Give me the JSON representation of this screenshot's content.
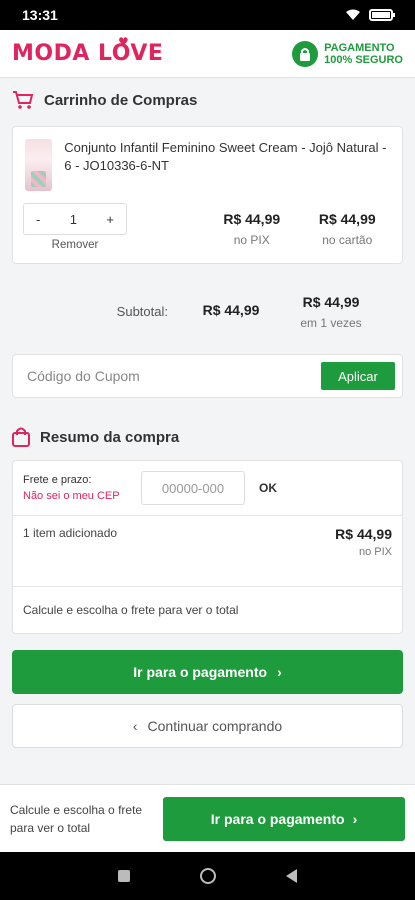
{
  "status_bar": {
    "time": "13:31"
  },
  "header": {
    "logo_text": "MODA LOVE",
    "secure_line1": "PAGAMENTO",
    "secure_line2": "100% SEGURO"
  },
  "cart": {
    "title": "Carrinho de Compras",
    "product_name": "Conjunto Infantil Feminino Sweet Cream - Jojô Natural - 6 - JO10336-6-NT",
    "quantity": "1",
    "minus_label": "-",
    "plus_label": "+",
    "remove_label": "Remover",
    "price_pix": "R$ 44,99",
    "price_pix_label": "no PIX",
    "price_card": "R$ 44,99",
    "price_card_label": "no cartão"
  },
  "subtotal": {
    "label": "Subtotal:",
    "pix_value": "R$ 44,99",
    "card_value": "R$ 44,99",
    "installments": "em 1 vezes"
  },
  "coupon": {
    "placeholder": "Código do Cupom",
    "apply_label": "Aplicar"
  },
  "summary": {
    "title": "Resumo da compra",
    "frete_label": "Frete e prazo:",
    "cep_link": "Não sei o meu CEP",
    "cep_placeholder": "00000-000",
    "ok_label": "OK",
    "items_label": "1 item adicionado",
    "items_price": "R$ 44,99",
    "items_price_label": "no PIX",
    "calc_note": "Calcule e escolha o frete para ver o total"
  },
  "actions": {
    "pay_label": "Ir para o pagamento",
    "continue_label": "Continuar comprando"
  },
  "bottom_bar": {
    "note": "Calcule e escolha o frete para ver o total",
    "pay_label": "Ir para o pagamento"
  },
  "colors": {
    "brand": "#e0245e",
    "primary": "#1e9b3c"
  }
}
